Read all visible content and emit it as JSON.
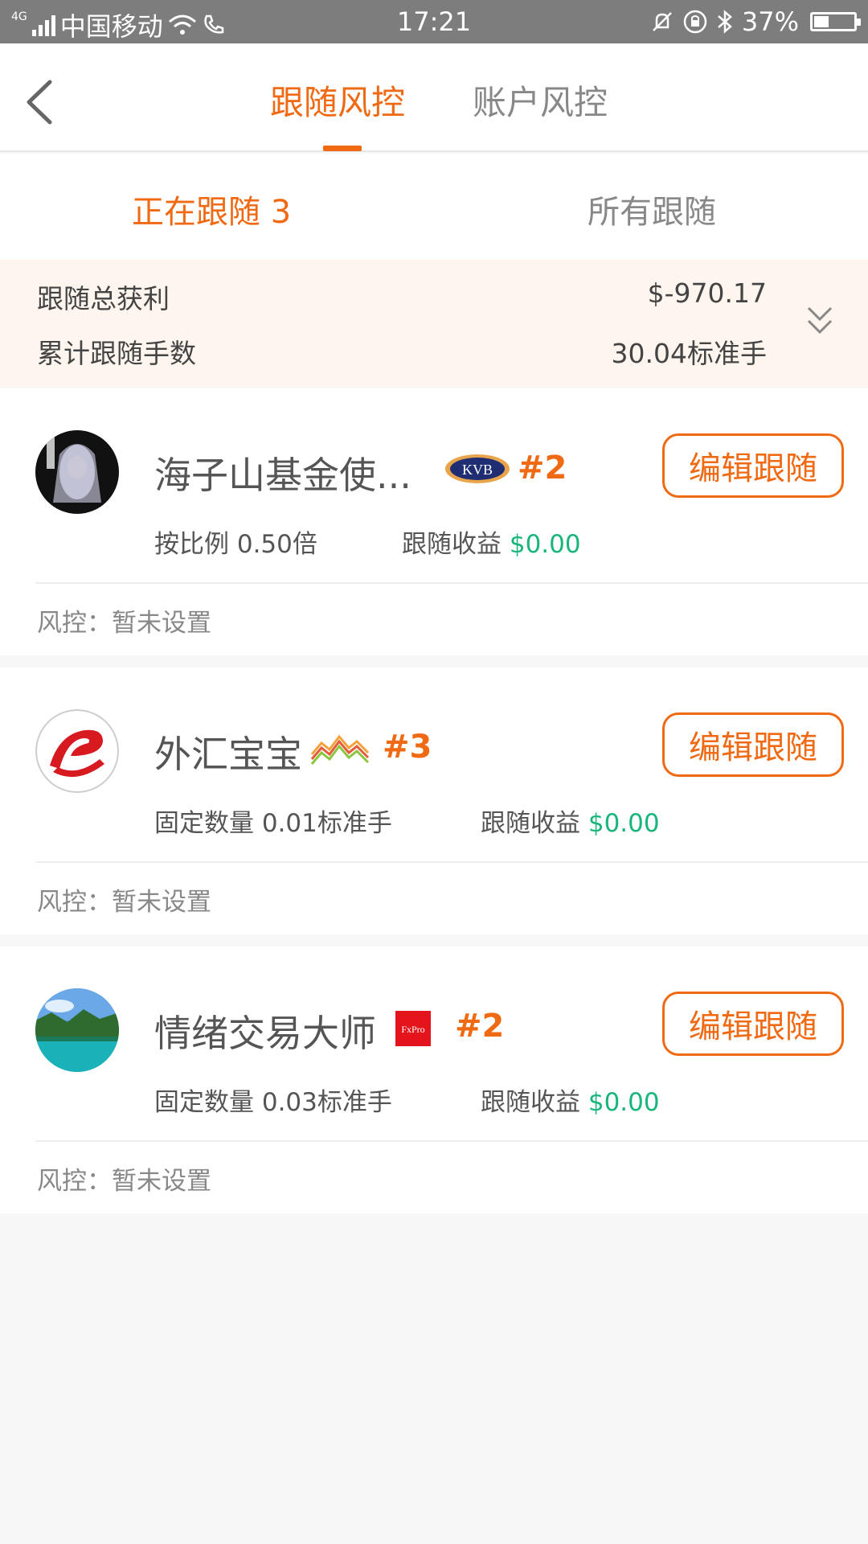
{
  "status_bar": {
    "network": "4G",
    "carrier": "中国移动",
    "time": "17:21",
    "battery": "37%"
  },
  "header": {
    "tabs": [
      {
        "label": "跟随风控",
        "active": true
      },
      {
        "label": "账户风控",
        "active": false
      }
    ]
  },
  "subtabs": {
    "following": "正在跟随 3",
    "all": "所有跟随"
  },
  "summary": {
    "total_profit_label": "跟随总获利",
    "total_profit_value": "$-970.17",
    "total_lots_label": "累计跟随手数",
    "total_lots_value": "30.04标准手"
  },
  "traders": [
    {
      "name": "海子山基金使...",
      "broker_icon": "kvb-logo",
      "broker_text": "KVB",
      "rank": "#2",
      "mode_label": "按比例",
      "mode_value": "0.50倍",
      "profit_label": "跟随收益",
      "profit_value": "$0.00",
      "risk_label": "风控：",
      "risk_value": "暂未设置",
      "edit_label": "编辑跟随"
    },
    {
      "name": "外汇宝宝",
      "broker_icon": "wave-logo",
      "broker_text": "",
      "rank": "#3",
      "mode_label": "固定数量",
      "mode_value": "0.01标准手",
      "profit_label": "跟随收益",
      "profit_value": "$0.00",
      "risk_label": "风控：",
      "risk_value": "暂未设置",
      "edit_label": "编辑跟随"
    },
    {
      "name": "情绪交易大师",
      "broker_icon": "fxpro-logo",
      "broker_text": "FxPro",
      "rank": "#2",
      "mode_label": "固定数量",
      "mode_value": "0.03标准手",
      "profit_label": "跟随收益",
      "profit_value": "$0.00",
      "risk_label": "风控：",
      "risk_value": "暂未设置",
      "edit_label": "编辑跟随"
    }
  ],
  "colors": {
    "accent": "#f06a14",
    "profit_green": "#19b57a",
    "summary_bg": "#fdf5ee"
  }
}
